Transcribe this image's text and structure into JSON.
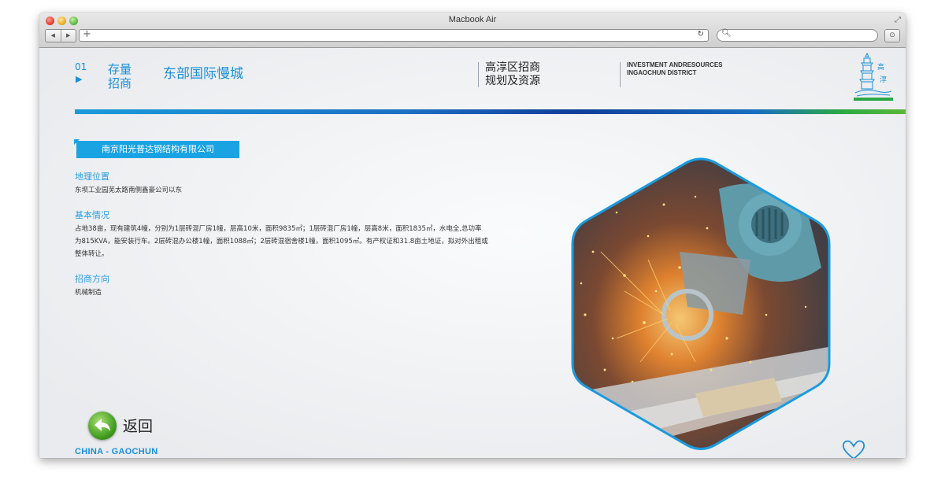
{
  "window": {
    "title": "Macbook Air"
  },
  "header": {
    "number": "01",
    "arrow": "▶",
    "section_line1": "存量",
    "section_line2": "招商",
    "page_title": "东部国际慢城",
    "region_line1": "高淳区招商",
    "region_line2": "规划及资源",
    "en_line1": "INVESTMENT ANDRESOURCES",
    "en_line2": "INGAOCHUN DISTRICT"
  },
  "company": {
    "name": "南京阳光普达钢结构有限公司"
  },
  "sections": {
    "location_label": "地理位置",
    "location_text": "东坝工业园芜太路南侧鑫豪公司以东",
    "basic_label": "基本情况",
    "basic_text": "占地38亩，现有建筑4幢，分别为1层砖混厂房1幢，层高10米，面积9835㎡；1层砖混厂房1幢，层高8米，面积1835㎡，水电全,总功率为815KVA，能安装行车。2层砖混办公楼1幢，面积1088㎡；2层砖混宿舍楼1幢，面积1095㎡。有产权证和31.8亩土地证，拟对外出租或整体转让。",
    "direction_label": "招商方向",
    "direction_text": "机械制造"
  },
  "back": {
    "label": "返回"
  },
  "footer": {
    "text": "CHINA - GAOCHUN"
  },
  "colors": {
    "accent": "#1a8fd8",
    "tag": "#19a3e3",
    "green": "#3e9a1e"
  }
}
